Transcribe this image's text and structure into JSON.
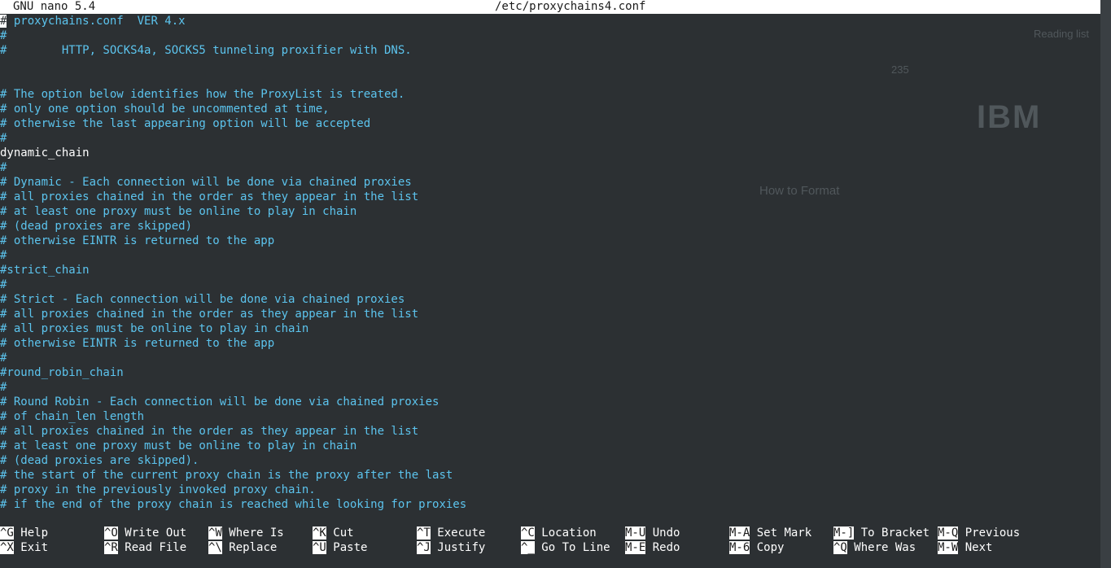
{
  "titlebar": {
    "app": "GNU nano 5.4",
    "file": "/etc/proxychains4.conf"
  },
  "lines": [
    {
      "t": "proxychains.conf  VER 4.x",
      "k": "comment",
      "cursor": true
    },
    {
      "t": "#",
      "k": "comment"
    },
    {
      "t": "#        HTTP, SOCKS4a, SOCKS5 tunneling proxifier with DNS.",
      "k": "comment"
    },
    {
      "t": "",
      "k": "comment"
    },
    {
      "t": "",
      "k": "comment"
    },
    {
      "t": "# The option below identifies how the ProxyList is treated.",
      "k": "comment"
    },
    {
      "t": "# only one option should be uncommented at time,",
      "k": "comment"
    },
    {
      "t": "# otherwise the last appearing option will be accepted",
      "k": "comment"
    },
    {
      "t": "#",
      "k": "comment"
    },
    {
      "t": "dynamic_chain",
      "k": "directive"
    },
    {
      "t": "#",
      "k": "comment"
    },
    {
      "t": "# Dynamic - Each connection will be done via chained proxies",
      "k": "comment"
    },
    {
      "t": "# all proxies chained in the order as they appear in the list",
      "k": "comment"
    },
    {
      "t": "# at least one proxy must be online to play in chain",
      "k": "comment"
    },
    {
      "t": "# (dead proxies are skipped)",
      "k": "comment"
    },
    {
      "t": "# otherwise EINTR is returned to the app",
      "k": "comment"
    },
    {
      "t": "#",
      "k": "comment"
    },
    {
      "t": "#strict_chain",
      "k": "comment"
    },
    {
      "t": "#",
      "k": "comment"
    },
    {
      "t": "# Strict - Each connection will be done via chained proxies",
      "k": "comment"
    },
    {
      "t": "# all proxies chained in the order as they appear in the list",
      "k": "comment"
    },
    {
      "t": "# all proxies must be online to play in chain",
      "k": "comment"
    },
    {
      "t": "# otherwise EINTR is returned to the app",
      "k": "comment"
    },
    {
      "t": "#",
      "k": "comment"
    },
    {
      "t": "#round_robin_chain",
      "k": "comment"
    },
    {
      "t": "#",
      "k": "comment"
    },
    {
      "t": "# Round Robin - Each connection will be done via chained proxies",
      "k": "comment"
    },
    {
      "t": "# of chain_len length",
      "k": "comment"
    },
    {
      "t": "# all proxies chained in the order as they appear in the list",
      "k": "comment"
    },
    {
      "t": "# at least one proxy must be online to play in chain",
      "k": "comment"
    },
    {
      "t": "# (dead proxies are skipped).",
      "k": "comment"
    },
    {
      "t": "# the start of the current proxy chain is the proxy after the last",
      "k": "comment"
    },
    {
      "t": "# proxy in the previously invoked proxy chain.",
      "k": "comment"
    },
    {
      "t": "# if the end of the proxy chain is reached while looking for proxies",
      "k": "comment"
    }
  ],
  "cursor_char": "#",
  "shortcuts": [
    {
      "key": "^G",
      "label": "Help"
    },
    {
      "key": "^X",
      "label": "Exit"
    },
    {
      "key": "^O",
      "label": "Write Out"
    },
    {
      "key": "^R",
      "label": "Read File"
    },
    {
      "key": "^W",
      "label": "Where Is"
    },
    {
      "key": "^\\",
      "label": "Replace"
    },
    {
      "key": "^K",
      "label": "Cut"
    },
    {
      "key": "^U",
      "label": "Paste"
    },
    {
      "key": "^T",
      "label": "Execute"
    },
    {
      "key": "^J",
      "label": "Justify"
    },
    {
      "key": "^C",
      "label": "Location"
    },
    {
      "key": "^_",
      "label": "Go To Line"
    },
    {
      "key": "M-U",
      "label": "Undo"
    },
    {
      "key": "M-E",
      "label": "Redo"
    },
    {
      "key": "M-A",
      "label": "Set Mark"
    },
    {
      "key": "M-6",
      "label": "Copy"
    },
    {
      "key": "M-]",
      "label": "To Bracket"
    },
    {
      "key": "^Q",
      "label": "Where Was"
    },
    {
      "key": "M-Q",
      "label": "Previous"
    },
    {
      "key": "M-W",
      "label": "Next"
    }
  ],
  "background_ghost": {
    "reading": "Reading list",
    "ibm": "IBM",
    "how_to_format": "How to Format",
    "stack_count": "235"
  },
  "colors": {
    "background": "#2c3033",
    "comment": "#5cc4ee",
    "directive": "#ffffff",
    "titlebar": "#ffffff"
  }
}
